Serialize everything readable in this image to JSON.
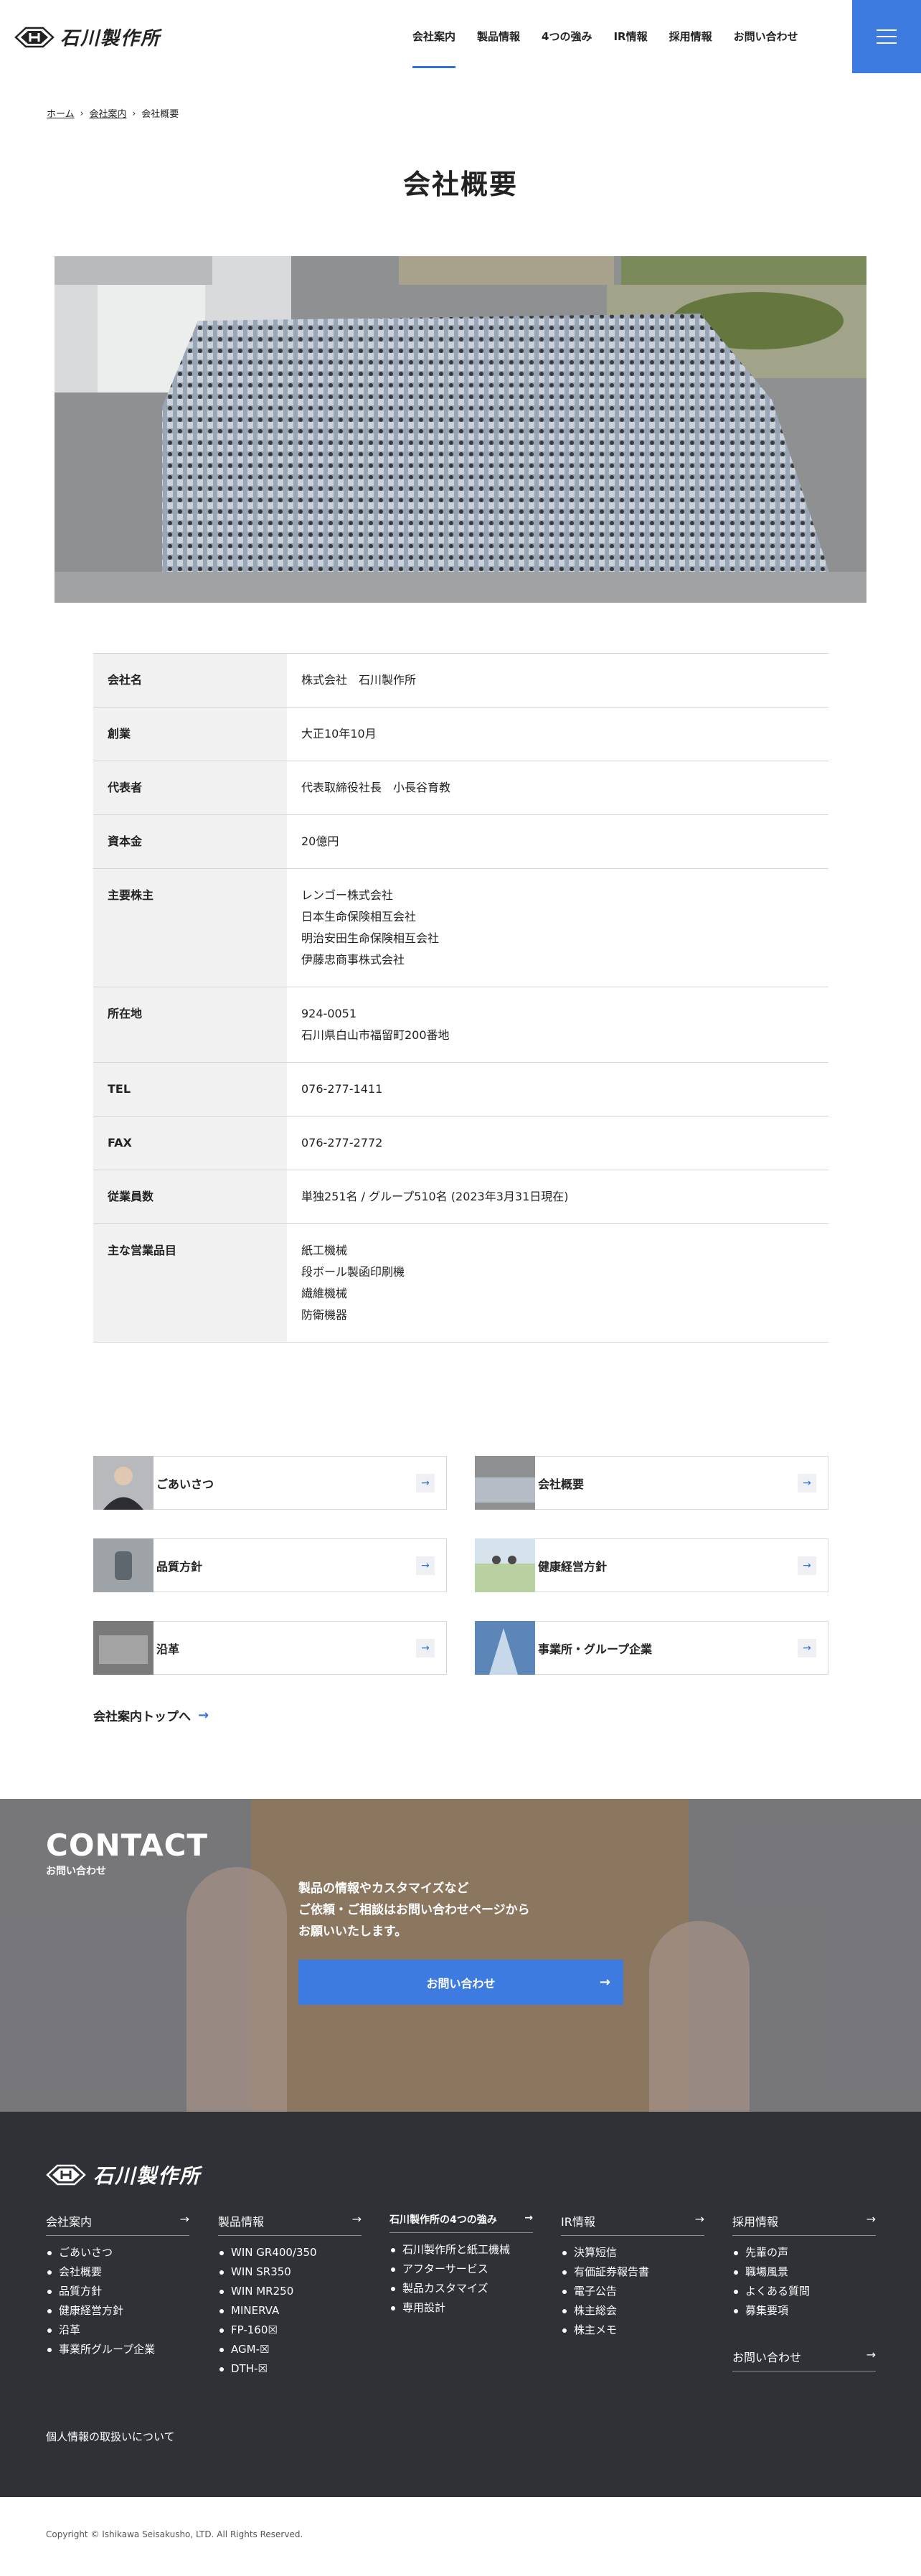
{
  "header": {
    "logo_text": "石川製作所",
    "nav": [
      {
        "label": "会社案内",
        "active": true
      },
      {
        "label": "製品情報",
        "active": false
      },
      {
        "label": "4つの強み",
        "active": false
      },
      {
        "label": "IR情報",
        "active": false
      },
      {
        "label": "採用情報",
        "active": false
      },
      {
        "label": "お問い合わせ",
        "active": false
      }
    ],
    "menu_icon": "hamburger-icon"
  },
  "breadcrumb": {
    "home": "ホーム",
    "parent": "会社案内",
    "current": "会社概要"
  },
  "page_title": "会社概要",
  "company_table": [
    {
      "label": "会社名",
      "value": [
        "株式会社　石川製作所"
      ]
    },
    {
      "label": "創業",
      "value": [
        "大正10年10月"
      ]
    },
    {
      "label": "代表者",
      "value": [
        "代表取締役社長　小長谷育教"
      ]
    },
    {
      "label": "資本金",
      "value": [
        "20億円"
      ]
    },
    {
      "label": "主要株主",
      "value": [
        "レンゴー株式会社",
        "日本生命保険相互会社",
        "明治安田生命保険相互会社",
        "伊藤忠商事株式会社"
      ]
    },
    {
      "label": "所在地",
      "value": [
        "924-0051",
        "石川県白山市福留町200番地"
      ]
    },
    {
      "label": "TEL",
      "value": [
        "076-277-1411"
      ]
    },
    {
      "label": "FAX",
      "value": [
        "076-277-2772"
      ]
    },
    {
      "label": "従業員数",
      "value": [
        "単独251名 / グループ510名 (2023年3月31日現在)"
      ]
    },
    {
      "label": "主な営業品目",
      "value": [
        "紙工機械",
        "段ボール製函印刷機",
        "繊維機械",
        "防衛機器"
      ]
    }
  ],
  "cards": [
    {
      "label": "ごあいさつ"
    },
    {
      "label": "会社概要"
    },
    {
      "label": "品質方針"
    },
    {
      "label": "健康経営方針"
    },
    {
      "label": "沿革"
    },
    {
      "label": "事業所・グループ企業"
    }
  ],
  "top_link": "会社案内トップへ",
  "contact": {
    "title_en": "CONTACT",
    "title_ja": "お問い合わせ",
    "text": [
      "製品の情報やカスタマイズなど",
      "ご依頼・ご相談はお問い合わせページから",
      "お願いいたします。"
    ],
    "button": "お問い合わせ"
  },
  "footer": {
    "logo_text": "石川製作所",
    "columns": [
      {
        "head": "会社案内",
        "items": [
          "ごあいさつ",
          "会社概要",
          "品質方針",
          "健康経営方針",
          "沿革",
          "事業所グループ企業"
        ]
      },
      {
        "head": "製品情報",
        "items": [
          "WIN GR400/350",
          "WIN SR350",
          "WIN MR250",
          "MINERVA",
          "FP-160☒",
          "AGM-☒",
          "DTH-☒"
        ]
      },
      {
        "head": "石川製作所の4つの強み",
        "items": [
          "石川製作所と紙工機械",
          "アフターサービス",
          "製品カスタマイズ",
          "専用設計"
        ]
      },
      {
        "head": "IR情報",
        "items": [
          "決算短信",
          "有価証券報告書",
          "電子公告",
          "株主総会",
          "株主メモ"
        ]
      },
      {
        "head": "採用情報",
        "items": [
          "先輩の声",
          "職場風景",
          "よくある質問",
          "募集要項"
        ]
      }
    ],
    "contact_link": "お問い合わせ",
    "privacy": "個人情報の取扱いについて",
    "copyright": "Copyright © Ishikawa Seisakusho, LTD. All Rights Reserved."
  },
  "colors": {
    "accent": "#3d7be0",
    "footer_bg": "#2f3136",
    "table_head_bg": "#f1f1f1"
  }
}
